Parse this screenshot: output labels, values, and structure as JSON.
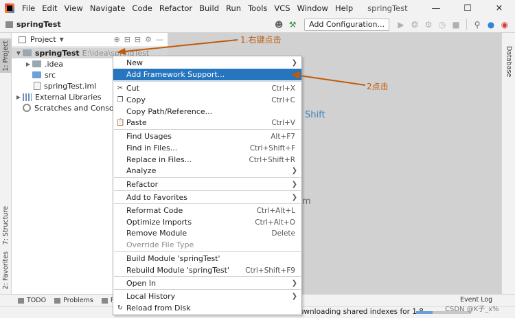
{
  "menubar": {
    "items": [
      "File",
      "Edit",
      "View",
      "Navigate",
      "Code",
      "Refactor",
      "Build",
      "Run",
      "Tools",
      "VCS",
      "Window",
      "Help"
    ],
    "window_title": "springTest"
  },
  "toolbar": {
    "project_name": "springTest",
    "add_configuration": "Add Configuration..."
  },
  "left_strip": {
    "project_tab": "1: Project",
    "structure_tab": "7: Structure",
    "favorites_tab": "2: Favorites"
  },
  "right_strip": {
    "database_tab": "Database"
  },
  "project_panel": {
    "title": "Project",
    "tree": [
      {
        "label": "springTest",
        "suffix": "E:\\idea\\springTest"
      },
      {
        "label": ".idea"
      },
      {
        "label": "src"
      },
      {
        "label": "springTest.iml"
      },
      {
        "label": "External Libraries"
      },
      {
        "label": "Scratches and Consoles"
      }
    ]
  },
  "editor_hints": {
    "shift": "Shift",
    "m": "m"
  },
  "context_menu": {
    "items": [
      {
        "label": "New",
        "shortcut": "",
        "submenu": true
      },
      {
        "label": "Add Framework Support...",
        "shortcut": "",
        "highlighted": true
      },
      {
        "label": "Cut",
        "shortcut": "Ctrl+X",
        "icon": "cut-icon"
      },
      {
        "label": "Copy",
        "shortcut": "Ctrl+C",
        "icon": "copy-icon"
      },
      {
        "label": "Copy Path/Reference...",
        "shortcut": ""
      },
      {
        "label": "Paste",
        "shortcut": "Ctrl+V",
        "icon": "paste-icon"
      },
      {
        "label": "Find Usages",
        "shortcut": "Alt+F7"
      },
      {
        "label": "Find in Files...",
        "shortcut": "Ctrl+Shift+F"
      },
      {
        "label": "Replace in Files...",
        "shortcut": "Ctrl+Shift+R"
      },
      {
        "label": "Analyze",
        "shortcut": "",
        "submenu": true
      },
      {
        "label": "Refactor",
        "shortcut": "",
        "submenu": true
      },
      {
        "label": "Add to Favorites",
        "shortcut": "",
        "submenu": true
      },
      {
        "label": "Reformat Code",
        "shortcut": "Ctrl+Alt+L"
      },
      {
        "label": "Optimize Imports",
        "shortcut": "Ctrl+Alt+O"
      },
      {
        "label": "Remove Module",
        "shortcut": "Delete"
      },
      {
        "label": "Override File Type",
        "shortcut": "",
        "disabled": true
      },
      {
        "label": "Build Module 'springTest'",
        "shortcut": ""
      },
      {
        "label": "Rebuild Module 'springTest'",
        "shortcut": "Ctrl+Shift+F9"
      },
      {
        "label": "Open In",
        "shortcut": "",
        "submenu": true
      },
      {
        "label": "Local History",
        "shortcut": "",
        "submenu": true
      },
      {
        "label": "Reload from Disk",
        "shortcut": "",
        "icon": "reload-icon"
      }
    ]
  },
  "annotations": {
    "step1": "1.右键点击",
    "step2": "2点击"
  },
  "bottom_tabs": [
    "TODO",
    "Problems",
    "F"
  ],
  "status": {
    "text": "ownloading shared indexes for 1.8",
    "event_log": "Event Log",
    "progress": 0.3,
    "watermark": "CSDN @K子_x%"
  },
  "colors": {
    "highlight": "#2675bf",
    "annotation": "#c05a0a",
    "editor_bg": "#d1d1d1"
  }
}
